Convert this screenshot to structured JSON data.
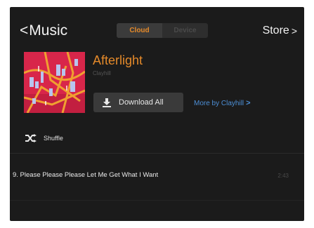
{
  "header": {
    "back_label": "Music",
    "tabs": [
      {
        "label": "Cloud",
        "active": true
      },
      {
        "label": "Device",
        "active": false
      }
    ],
    "store_label": "Store"
  },
  "album": {
    "title": "Afterlight",
    "artist": "Clayhill",
    "download_label": "Download All",
    "more_label": "More by Clayhill"
  },
  "shuffle_label": "Shuffle",
  "tracks": [
    {
      "name": "9. Please Please Please Let Me Get What I Want",
      "duration": "2:43"
    }
  ],
  "colors": {
    "accent": "#e58a2a",
    "link": "#4d8fd6",
    "background": "#1b1b1b"
  }
}
